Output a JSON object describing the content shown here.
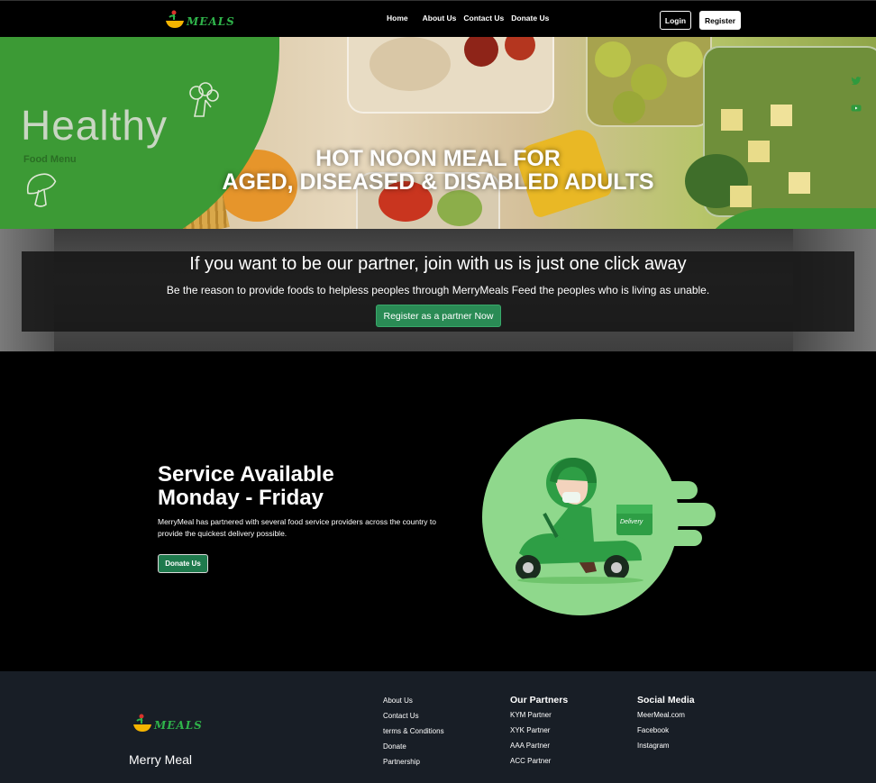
{
  "nav": {
    "logo_text": "MEALS",
    "links": [
      "Home",
      "About Us",
      "Contact Us",
      "Donate Us"
    ],
    "login_label": "Login",
    "register_label": "Register"
  },
  "hero": {
    "healthy_text": "Healthy",
    "food_menu_text": "Food Menu",
    "title_line1": "HOT NOON MEAL FOR",
    "title_line2": "AGED, DISEASED & DISABLED ADULTS",
    "social_icons": [
      "twitter-icon",
      "youtube-icon"
    ]
  },
  "partner": {
    "title": "If you want to be our partner, join with us is just one click away",
    "subtitle": "Be the reason to provide foods to helpless peoples through MerryMeals Feed the peoples who is living as unable.",
    "button_label": "Register as a partner Now"
  },
  "service": {
    "title_line1": "Service Available",
    "title_line2": "Monday - Friday",
    "description": "MerryMeal has partnered with several food service providers across the country to provide the quickest delivery possible.",
    "button_label": "Donate Us",
    "illustration_text": "Delivery"
  },
  "footer": {
    "logo_text": "MEALS",
    "brand": "Merry Meal",
    "links": [
      "About Us",
      "Contact Us",
      "terms & Conditions",
      "Donate",
      "Partnership"
    ],
    "partners_heading": "Our Partners",
    "partners": [
      "KYM Partner",
      "XYK Partner",
      "AAA Partner",
      "ACC Partner"
    ],
    "social_heading": "Social Media",
    "social": [
      "MeerMeal.com",
      "Facebook",
      "Instagram"
    ]
  },
  "colors": {
    "brand_green": "#2fb34a",
    "hero_green": "#3c9a35",
    "button_green": "#2a8b55",
    "footer_bg": "#181e26"
  }
}
